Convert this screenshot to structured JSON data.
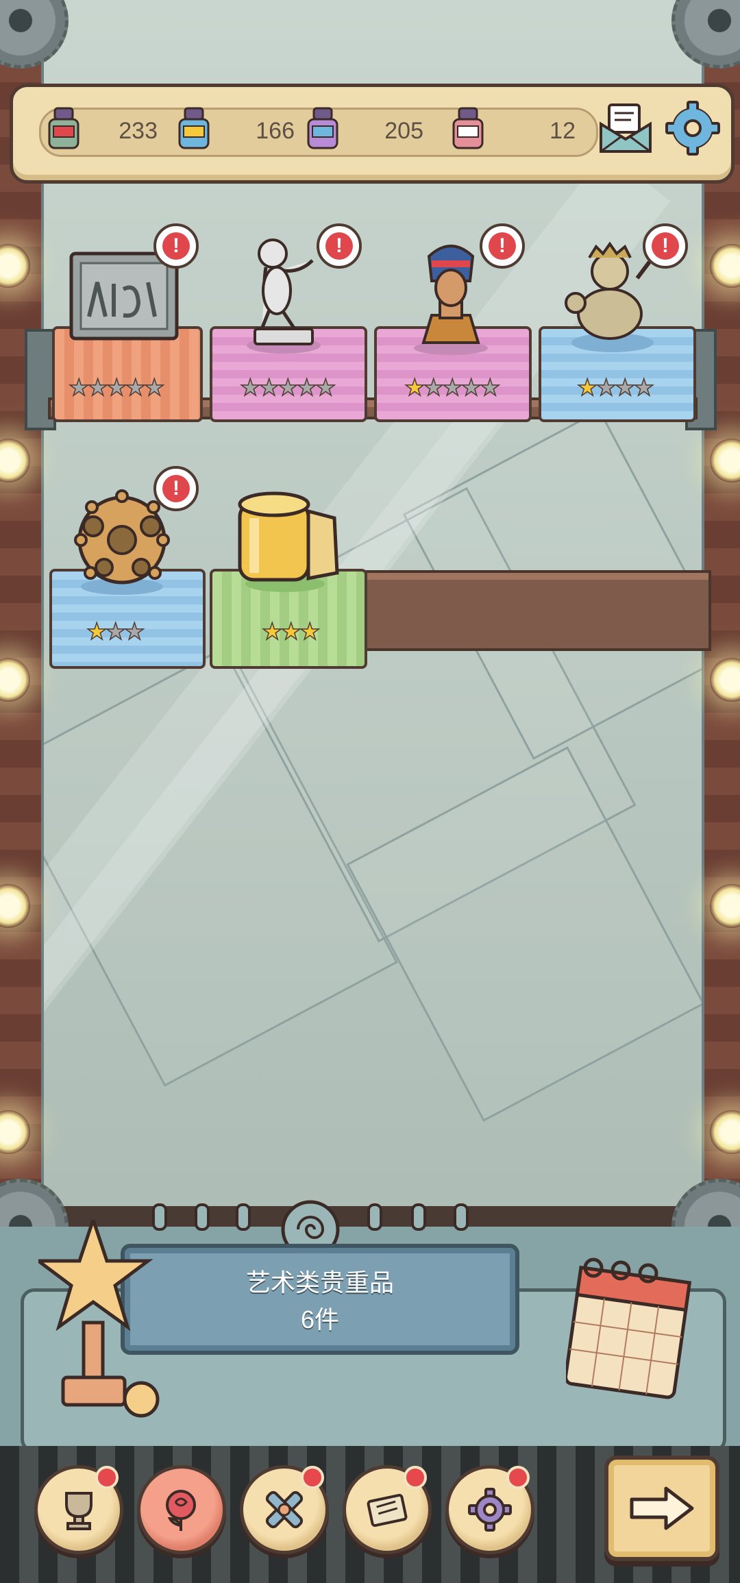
{
  "resources": [
    {
      "name": "ink-gray",
      "value": "",
      "color": "#8fb39a"
    },
    {
      "name": "ink-blue",
      "value": "233",
      "color": "#6fb6de"
    },
    {
      "name": "ink-purple",
      "value": "166",
      "color": "#b78bd6"
    },
    {
      "name": "ink-pink",
      "value": "205",
      "color": "#e58f9a"
    },
    {
      "name": "ink-red",
      "value": "12",
      "color": "#d06a6a"
    }
  ],
  "exhibits": [
    {
      "name": "tablet",
      "cloth": "orange",
      "stars_on": 0,
      "stars_total": 5,
      "alert": "!"
    },
    {
      "name": "cherub-statue",
      "cloth": "pink",
      "stars_on": 0,
      "stars_total": 5,
      "alert": "!"
    },
    {
      "name": "nefertiti-bust",
      "cloth": "pink",
      "stars_on": 1,
      "stars_total": 5,
      "alert": "!"
    },
    {
      "name": "bronze-idol",
      "cloth": "blue",
      "stars_on": 1,
      "stars_total": 4,
      "alert": "!"
    },
    {
      "name": "dodecahedron",
      "cloth": "blue",
      "stars_on": 1,
      "stars_total": 3,
      "alert": "!"
    },
    {
      "name": "golden-scroll",
      "cloth": "green",
      "stars_on": 3,
      "stars_total": 3,
      "alert": ""
    }
  ],
  "sign": {
    "title": "艺术类贵重品",
    "count": "6件"
  },
  "nav": [
    {
      "icon": "trophy-icon",
      "badge": true,
      "active": false
    },
    {
      "icon": "rose-icon",
      "badge": false,
      "active": true
    },
    {
      "icon": "cross-icon",
      "badge": true,
      "active": false
    },
    {
      "icon": "scroll-icon",
      "badge": true,
      "active": false
    },
    {
      "icon": "gear-icon",
      "badge": true,
      "active": false
    }
  ],
  "colors": {
    "alert_red": "#e0474c",
    "star_on": "#f5c93a",
    "star_off": "#a9a9a9",
    "frame_wood": "#7a4a3c"
  }
}
